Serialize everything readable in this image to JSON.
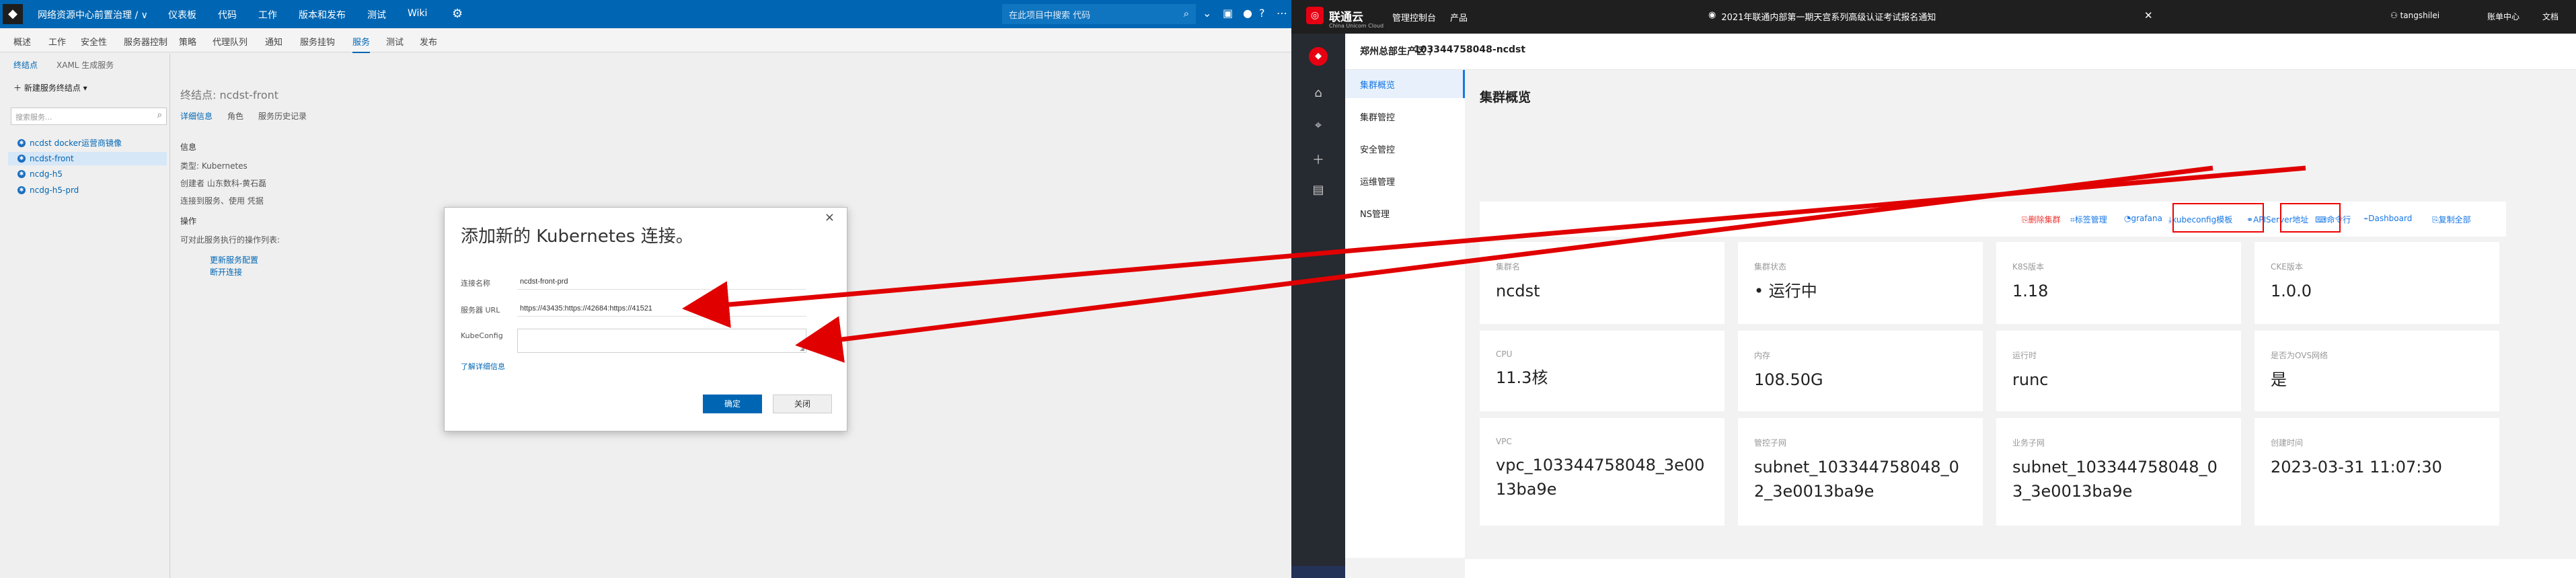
{
  "tfs": {
    "logo": "◆",
    "project": "网络资源中心前置治理 / ∨",
    "nav": [
      "仪表板",
      "代码",
      "工作",
      "版本和发布",
      "测试",
      "Wiki"
    ],
    "search_placeholder": "在此项目中搜索 代码",
    "subtabs": [
      "概述",
      "工作",
      "安全性",
      "服务器控制",
      "策略",
      "代理队列",
      "通知",
      "服务挂钩",
      "服务",
      "测试",
      "发布"
    ],
    "active_subtab": "服务",
    "breadcrumb": [
      "终结点",
      "XAML 生成服务"
    ],
    "new_endpoint": "新建服务终结点 ▾",
    "filter_placeholder": "搜索服务...",
    "endpoints": [
      "ncdst docker运营商镜像",
      "ncdst-front",
      "ncdg-h5",
      "ncdg-h5-prd"
    ],
    "selected_endpoint": "ncdst-front",
    "detail": {
      "title": "终结点: ncdst-front",
      "tabs": [
        "详细信息",
        "角色",
        "服务历史记录"
      ],
      "info_heading": "信息",
      "type": "类型: Kubernetes",
      "created_by": "创建者 山东数科-黄石磊",
      "connect": "连接到服务、使用 凭据",
      "actions_heading": "操作",
      "actions_desc": "可对此服务执行的操作列表:",
      "link1": "更新服务配置",
      "link2": "断开连接"
    },
    "dialog": {
      "title": "添加新的 Kubernetes 连接。",
      "conn_label": "连接名称",
      "conn_value": "ncdst-front-prd",
      "url_label": "服务器 URL",
      "url_value": "https://43435:https://42684:https://41521",
      "kube_label": "KubeConfig",
      "learn_more": "了解详细信息",
      "ok": "确定",
      "close": "关闭"
    }
  },
  "uc": {
    "brand": "联通云",
    "brand_sub": "China Unicom Cloud",
    "console": "管理控制台",
    "products": "产品",
    "notice": "2021年联通内部第一期天宫系列高级认证考试报名通知",
    "user": "tangshilei",
    "account": "账单中心",
    "docs": "文档",
    "crumb_region": "郑州总部生产区 /",
    "crumb_cluster": "103344758048-ncdst",
    "menu": [
      "集群概览",
      "集群管控",
      "安全管控",
      "运维管理",
      "NS管理"
    ],
    "active_menu": "集群概览",
    "heading": "集群概览",
    "actions": [
      "删除集群",
      "标签管理",
      "grafana",
      "kubeconfig模板",
      "APIServer地址",
      "命令行",
      "Dashboard",
      "复制全部"
    ],
    "cards": [
      {
        "k": "集群名",
        "v": "ncdst"
      },
      {
        "k": "集群状态",
        "v": "• 运行中"
      },
      {
        "k": "K8S版本",
        "v": "1.18"
      },
      {
        "k": "CKE版本",
        "v": "1.0.0"
      },
      {
        "k": "CPU",
        "v": "11.3核"
      },
      {
        "k": "内存",
        "v": "108.50G"
      },
      {
        "k": "运行时",
        "v": "runc"
      },
      {
        "k": "是否为OVS网络",
        "v": "是"
      },
      {
        "k": "VPC",
        "v": "vpc_103344758048_3e0013ba9e"
      },
      {
        "k": "管控子网",
        "v": "subnet_103344758048_02_3e0013ba9e"
      },
      {
        "k": "业务子网",
        "v": "subnet_103344758048_03_3e0013ba9e"
      },
      {
        "k": "创建时间",
        "v": "2023-03-31 11:07:30"
      }
    ],
    "colors": {
      "accent": "#1677e5",
      "brand": "#e60012",
      "annotation": "#e00000"
    }
  }
}
